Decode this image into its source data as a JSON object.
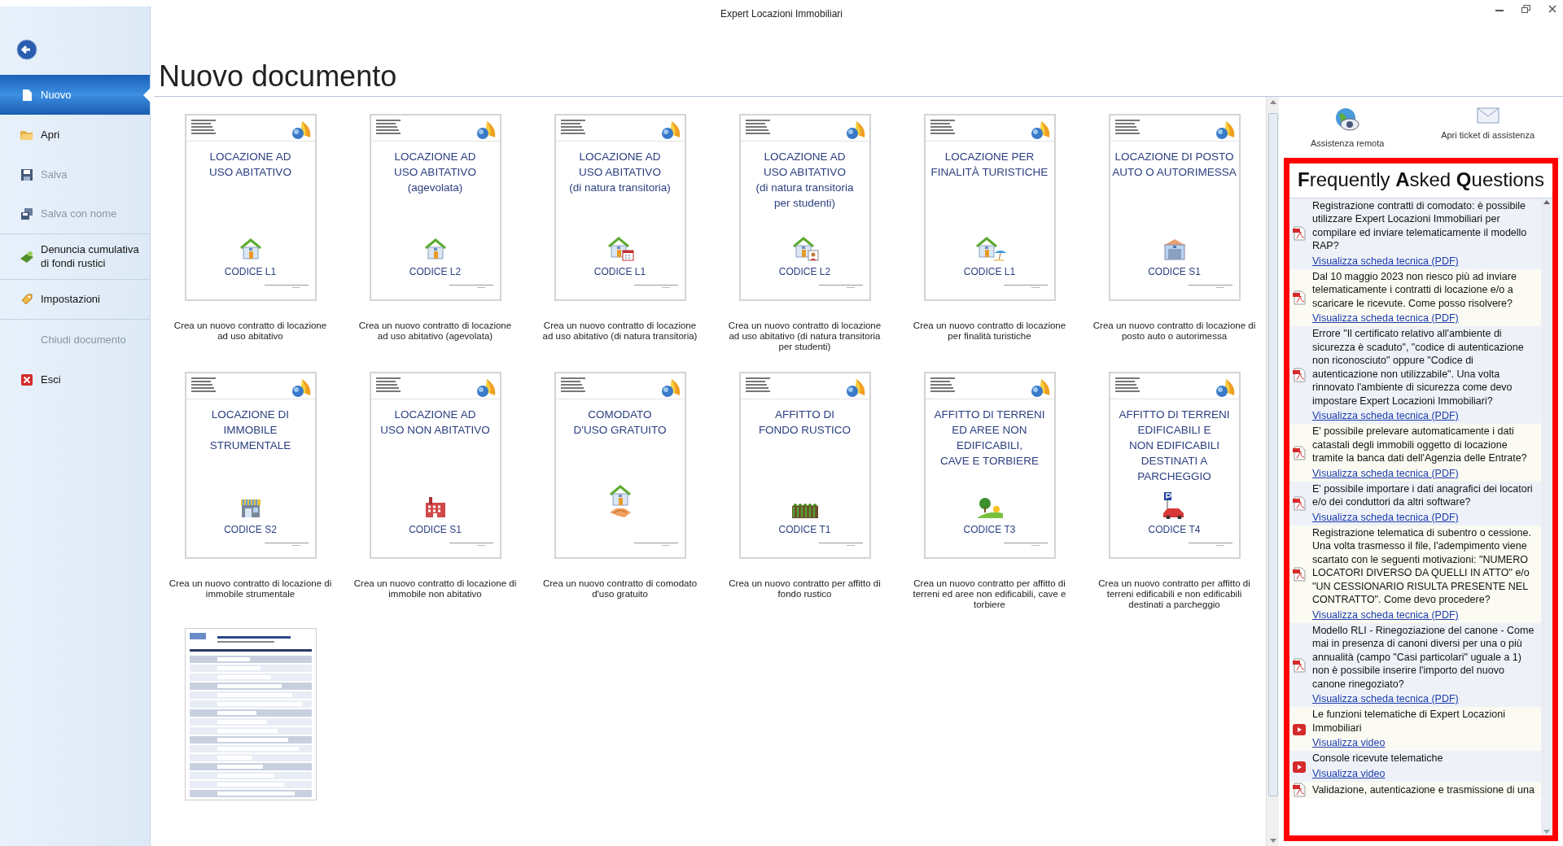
{
  "window": {
    "title": "Expert Locazioni Immobiliari"
  },
  "sidebar": {
    "items": [
      {
        "label": "Nuovo",
        "selected": true,
        "disabled": false,
        "divider_after": false
      },
      {
        "label": "Apri",
        "selected": false,
        "disabled": false,
        "divider_after": false
      },
      {
        "label": "Salva",
        "selected": false,
        "disabled": true,
        "divider_after": false
      },
      {
        "label": "Salva con nome",
        "selected": false,
        "disabled": true,
        "divider_after": true
      },
      {
        "label": "Denuncia cumulativa\ndi fondi rustici",
        "selected": false,
        "disabled": false,
        "divider_after": true
      },
      {
        "label": "Impostazioni",
        "selected": false,
        "disabled": false,
        "divider_after": true
      },
      {
        "label": "Chiudi documento",
        "selected": false,
        "disabled": true,
        "divider_after": false
      },
      {
        "label": "Esci",
        "selected": false,
        "disabled": false,
        "divider_after": false
      }
    ]
  },
  "heading": "Nuovo documento",
  "tiles": [
    {
      "kind": "contract",
      "title": "LOCAZIONE AD\nUSO ABITATIVO",
      "code": "CODICE L1",
      "caption": "Crea un nuovo contratto di locazione\nad uso abitativo"
    },
    {
      "kind": "contract",
      "title": "LOCAZIONE AD\nUSO ABITATIVO\n(agevolata)",
      "code": "CODICE L2",
      "caption": "Crea un nuovo contratto di locazione\nad uso abitativo (agevolata)"
    },
    {
      "kind": "contract",
      "title": "LOCAZIONE AD\nUSO ABITATIVO\n(di natura transitoria)",
      "code": "CODICE L1",
      "caption": "Crea un nuovo contratto di locazione\nad uso abitativo (di natura transitoria)"
    },
    {
      "kind": "contract",
      "title": "LOCAZIONE AD\nUSO ABITATIVO\n(di natura transitoria\nper studenti)",
      "code": "CODICE L2",
      "caption": "Crea un nuovo contratto di locazione\nad uso abitativo (di natura transitoria\nper studenti)"
    },
    {
      "kind": "contract",
      "title": "LOCAZIONE PER\nFINALITÀ TURISTICHE",
      "code": "CODICE L1",
      "caption": "Crea un nuovo contratto di locazione\nper finalità turistiche"
    },
    {
      "kind": "contract",
      "title": "LOCAZIONE DI POSTO\nAUTO O AUTORIMESSA",
      "code": "CODICE S1",
      "caption": "Crea un nuovo contratto di locazione di\nposto auto o autorimessa"
    },
    {
      "kind": "contract",
      "title": "LOCAZIONE DI\nIMMOBILE\nSTRUMENTALE",
      "code": "CODICE S2",
      "caption": "Crea un nuovo contratto di locazione di\nimmobile strumentale"
    },
    {
      "kind": "contract",
      "title": "LOCAZIONE AD\nUSO NON ABITATIVO",
      "code": "CODICE S1",
      "caption": "Crea un nuovo contratto di locazione di\nimmobile non abitativo"
    },
    {
      "kind": "contract",
      "title": "COMODATO\nD'USO GRATUITO",
      "caption": "Crea un nuovo contratto di comodato\nd'uso gratuito"
    },
    {
      "kind": "contract",
      "title": "AFFITTO DI\nFONDO RUSTICO",
      "code": "CODICE T1",
      "caption": "Crea un nuovo contratto per affitto di\nfondo rustico"
    },
    {
      "kind": "contract",
      "title": "AFFITTO DI TERRENI\nED AREE NON\nEDIFICABILI,\nCAVE E TORBIERE",
      "code": "CODICE T3",
      "caption": "Crea un nuovo contratto per affitto di\nterreni ed aree non edificabili, cave e\ntorbiere"
    },
    {
      "kind": "contract",
      "title": "AFFITTO DI TERRENI\nEDIFICABILI E\nNON EDIFICABILI\nDESTINATI A\nPARCHEGGIO",
      "code": "CODICE T4",
      "caption": "Crea un nuovo contratto per affitto di\nterreni edificabili e non edificabili\ndestinati a parcheggio"
    },
    {
      "kind": "form"
    }
  ],
  "support": [
    {
      "label": "Assistenza remota"
    },
    {
      "label": "Apri ticket di assistenza"
    }
  ],
  "faq": {
    "title": "**F**requently **A**sked **Q**uestions",
    "items": [
      {
        "kind": "pdf",
        "text": "Registrazione contratti di comodato: è possibile utilizzare Expert Locazioni Immobiliari per compilare ed inviare telematicamente il modello RAP?",
        "link": "Visualizza scheda tecnica (PDF)"
      },
      {
        "kind": "pdf",
        "text": "Dal 10 maggio 2023 non riesco più ad inviare telematicamente i contratti di locazione e/o a scaricare le ricevute. Come posso risolvere?",
        "link": "Visualizza scheda tecnica (PDF)"
      },
      {
        "kind": "pdf",
        "text": "Errore \"Il certificato relativo all'ambiente di sicurezza è scaduto\", \"codice di autenticazione non riconosciuto\" oppure \"Codice di autenticazione non utilizzabile\". Una volta rinnovato l'ambiente di sicurezza come devo impostare Expert Locazioni Immobiliari?",
        "link": "Visualizza scheda tecnica (PDF)"
      },
      {
        "kind": "pdf",
        "text": "E' possibile prelevare automaticamente i dati catastali degli immobili oggetto di locazione tramite la banca dati dell'Agenzia delle Entrate?",
        "link": "Visualizza scheda tecnica (PDF)"
      },
      {
        "kind": "pdf",
        "text": "E' possibile importare i dati anagrafici dei locatori e/o dei conduttori da altri software?",
        "link": "Visualizza scheda tecnica (PDF)"
      },
      {
        "kind": "pdf",
        "text": "Registrazione telematica di subentro o cessione. Una volta trasmesso il file, l'adempimento viene scartato con le seguenti motivazioni: \"NUMERO LOCATORI DIVERSO DA QUELLI IN ATTO\" e/o \"UN CESSIONARIO RISULTA PRESENTE NEL CONTRATTO\". Come devo procedere?",
        "link": "Visualizza scheda tecnica (PDF)"
      },
      {
        "kind": "pdf",
        "text": "Modello RLI - Rinegoziazione del canone - Come mai in presenza di canoni diversi per una o più annualità (campo \"Casi particolari\" uguale a 1) non è possibile inserire l'importo del nuovo canone rinegoziato?",
        "link": "Visualizza scheda tecnica (PDF)"
      },
      {
        "kind": "video",
        "text": "Le funzioni telematiche di Expert Locazioni Immobiliari",
        "link": "Visualizza video"
      },
      {
        "kind": "video",
        "text": "Console ricevute telematiche",
        "link": "Visualizza video"
      },
      {
        "kind": "pdf",
        "text": "Validazione, autenticazione e trasmissione di una"
      }
    ]
  }
}
